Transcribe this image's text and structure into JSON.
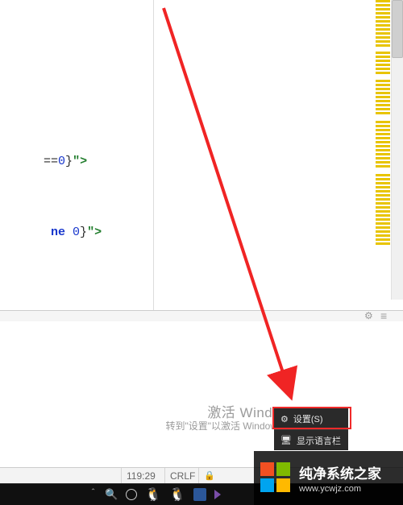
{
  "editor": {
    "frag1_prefix": "==",
    "frag1_num": "0",
    "frag1_brace": "}",
    "frag1_strend": "\">",
    "frag2_kw": " ne ",
    "frag2_num": "0",
    "frag2_brace": "}",
    "frag2_strend": "\">"
  },
  "status": {
    "position": "119:29",
    "line_ending": "CRLF",
    "lock_icon": "🔒"
  },
  "activate": {
    "title": "激活 Windows",
    "sub": "转到\"设置\"以激活 Windows"
  },
  "ime": {
    "settings_label": "设置(S)",
    "langbar_label": "显示语言栏"
  },
  "icons": {
    "gear": "⚙",
    "menu": "≡",
    "chevron_up": "＾",
    "search": "🔍",
    "monitor": "🖥"
  },
  "site": {
    "title": "纯净系统之家",
    "url": "www.ycwjz.com"
  }
}
